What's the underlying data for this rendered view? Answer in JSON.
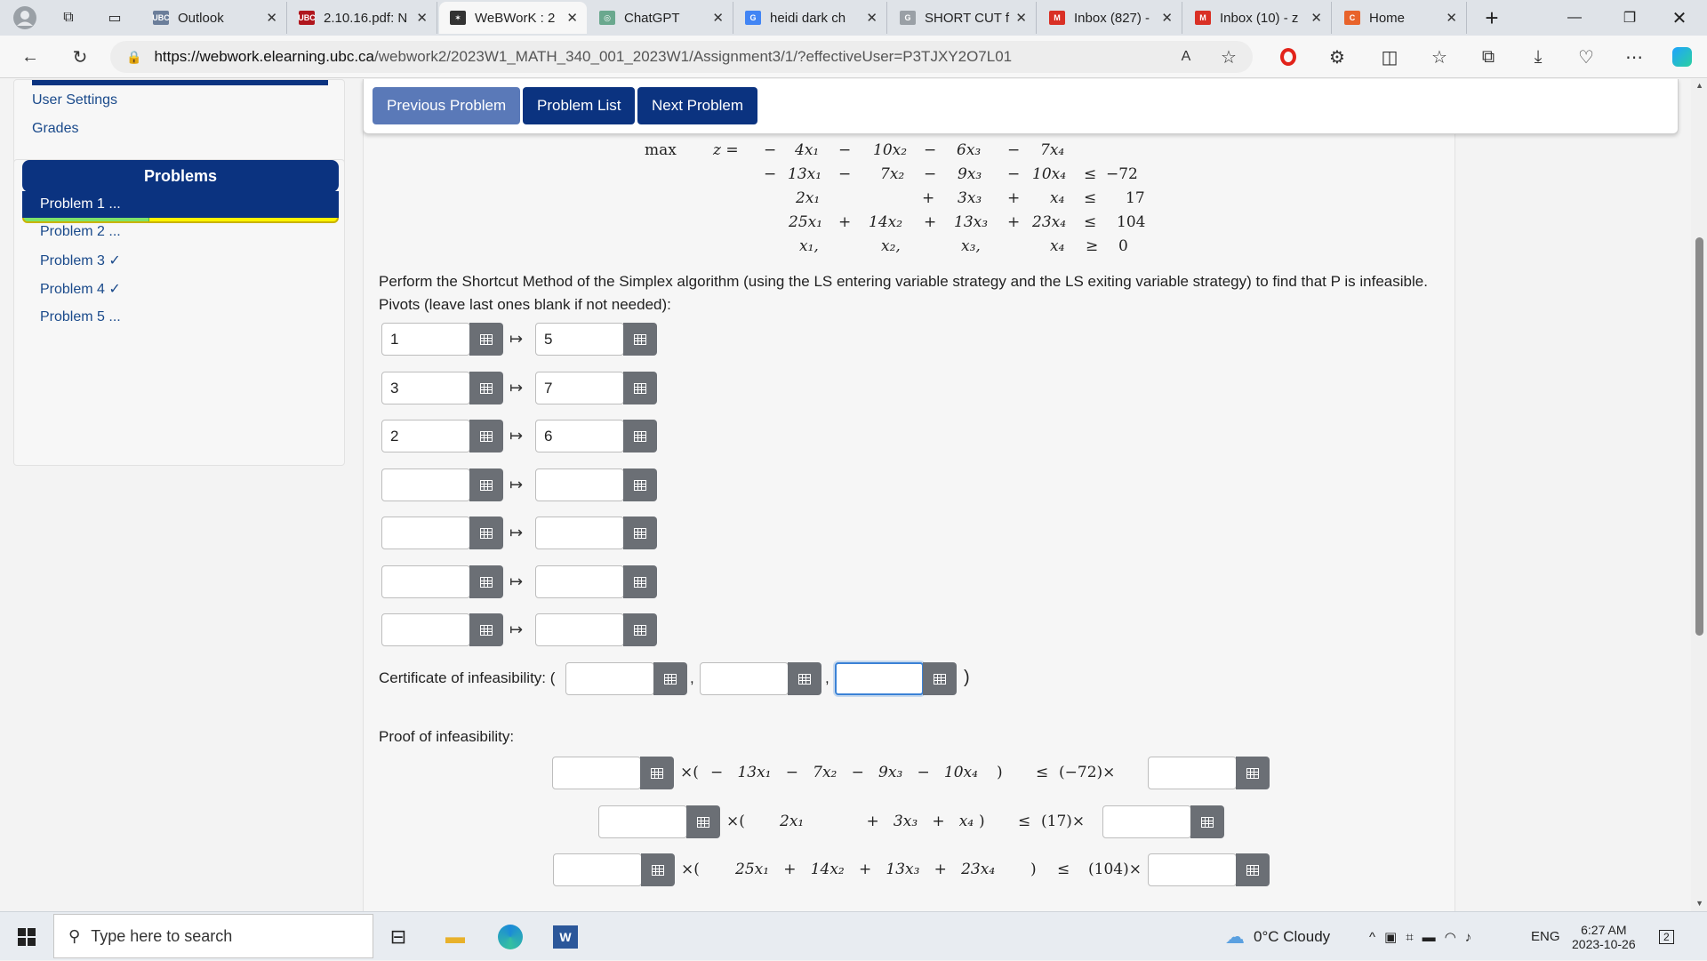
{
  "browser": {
    "tabs": [
      {
        "label": "Outlook",
        "favicon": "UBC",
        "favicon_color": "#6b7e9a"
      },
      {
        "label": "2.10.16.pdf: N",
        "favicon": "UBC",
        "favicon_color": "#b0161d"
      },
      {
        "label": "WeBWorK : 2",
        "favicon": "✶",
        "favicon_color": "#333333"
      },
      {
        "label": "ChatGPT",
        "favicon": "◎",
        "favicon_color": "#6aa88e"
      },
      {
        "label": "heidi dark ch",
        "favicon": "G",
        "favicon_color": "#4285f4"
      },
      {
        "label": "SHORT CUT f",
        "favicon": "G",
        "favicon_color": "#9aa0a6"
      },
      {
        "label": "Inbox (827) -",
        "favicon": "M",
        "favicon_color": "#d93025"
      },
      {
        "label": "Inbox (10) - z",
        "favicon": "M",
        "favicon_color": "#d93025"
      },
      {
        "label": "Home",
        "favicon": "C",
        "favicon_color": "#e8632b"
      }
    ],
    "url_host": "https://webwork.elearning.ubc.ca",
    "url_path": "/webwork2/2023W1_MATH_340_001_2023W1/Assignment3/1/?effectiveUser=P3TJXY2O7L01"
  },
  "sidebar": {
    "user_settings": "User Settings",
    "grades": "Grades",
    "problems_header": "Problems",
    "progress_fraction": 0.4,
    "problems": [
      {
        "label": "Problem 1 ...",
        "active": true
      },
      {
        "label": "Problem 2 ...",
        "active": false
      },
      {
        "label": "Problem 3 ✓",
        "active": false
      },
      {
        "label": "Problem 4 ✓",
        "active": false
      },
      {
        "label": "Problem 5 ...",
        "active": false
      }
    ]
  },
  "nav": {
    "prev": "Previous Problem",
    "list": "Problem List",
    "next": "Next Problem"
  },
  "lp": {
    "max": "max",
    "z": "z =",
    "obj": [
      "−",
      "4x₁",
      "−",
      "10x₂",
      "−",
      "6x₃",
      "−",
      "7x₄"
    ],
    "row1": [
      "−",
      "13x₁",
      "−",
      "7x₂",
      "−",
      "9x₃",
      "−",
      "10x₄",
      "≤",
      "−72"
    ],
    "row2": [
      "2x₁",
      "+",
      "3x₃",
      "+",
      "x₄",
      "≤",
      "17"
    ],
    "row3": [
      "25x₁",
      "+",
      "14x₂",
      "+",
      "13x₃",
      "+",
      "23x₄",
      "≤",
      "104"
    ],
    "row4": [
      "x₁,",
      "x₂,",
      "x₃,",
      "x₄",
      "≥",
      "0"
    ]
  },
  "problem": {
    "instruction": "Perform the Shortcut Method of the Simplex algorithm (using the LS entering variable strategy and the LS exiting variable strategy) to find that P is infeasible.",
    "pivots_label": "Pivots (leave last ones blank if not needed):",
    "mapsto": "↦",
    "pivots": [
      {
        "enter": "1",
        "exit": "5"
      },
      {
        "enter": "3",
        "exit": "7"
      },
      {
        "enter": "2",
        "exit": "6"
      },
      {
        "enter": "",
        "exit": ""
      },
      {
        "enter": "",
        "exit": ""
      },
      {
        "enter": "",
        "exit": ""
      },
      {
        "enter": "",
        "exit": ""
      }
    ],
    "certificate_label": "Certificate of infeasibility: (",
    "certificate_close": ")",
    "comma": ",",
    "proof_label": "Proof of infeasibility:",
    "proof_rows": [
      {
        "open": "×(",
        "terms": "−   13x₁   −   7x₂   −   9x₃   −   10x₄",
        "close": ")",
        "rel": "≤",
        "rhs": "(−72)×"
      },
      {
        "open": "×(",
        "terms": "2x₁             +   3x₃   +   x₄",
        "close": ")",
        "rel": "≤",
        "rhs": "(17)×"
      },
      {
        "open": "×(",
        "terms": "25x₁   +   14x₂   +   13x₃   +   23x₄",
        "close": ")",
        "rel": "≤",
        "rhs": "(104)×"
      }
    ]
  },
  "taskbar": {
    "search_placeholder": "Type here to search",
    "weather": "0°C  Cloudy",
    "lang": "ENG",
    "time": "6:27 AM",
    "date": "2023-10-26",
    "notifications": "2"
  }
}
